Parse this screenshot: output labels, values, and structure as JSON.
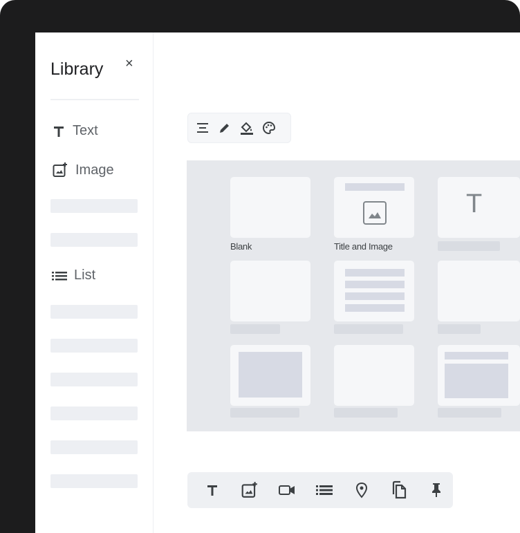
{
  "sidebar": {
    "title": "Library",
    "close_label": "×",
    "items": [
      {
        "label": "Text",
        "icon": "text-icon"
      },
      {
        "label": "Image",
        "icon": "add-image-icon"
      },
      {
        "label": "List",
        "icon": "list-icon"
      }
    ]
  },
  "top_toolbar": {
    "buttons": [
      {
        "icon": "align-icon"
      },
      {
        "icon": "pencil-icon"
      },
      {
        "icon": "fill-color-icon"
      },
      {
        "icon": "palette-icon"
      }
    ]
  },
  "templates": {
    "captions": [
      "Blank",
      "Title and Image"
    ],
    "text_glyph": "T"
  },
  "bottom_toolbar": {
    "buttons": [
      {
        "icon": "text-icon",
        "glyph": "T"
      },
      {
        "icon": "add-image-icon"
      },
      {
        "icon": "video-icon"
      },
      {
        "icon": "list-icon"
      },
      {
        "icon": "location-pin-icon"
      },
      {
        "icon": "copy-icon"
      },
      {
        "icon": "pin-icon"
      }
    ]
  },
  "colors": {
    "frame": "#1c1c1d",
    "canvas": "#e6e8ec",
    "card": "#f6f7f9",
    "placeholder": "#edeff3",
    "icon": "#3c4043"
  }
}
